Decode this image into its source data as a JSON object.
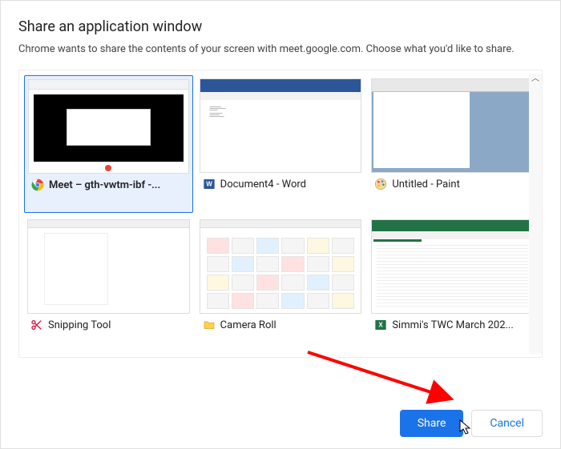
{
  "title": "Share an application window",
  "subtitle": "Chrome wants to share the contents of your screen with meet.google.com. Choose what you'd like to share.",
  "windows": [
    {
      "label": "Meet – gth-vwtm-ibf -...",
      "app": "chrome",
      "selected": true
    },
    {
      "label": "Document4 - Word",
      "app": "word",
      "selected": false
    },
    {
      "label": "Untitled - Paint",
      "app": "paint",
      "selected": false
    },
    {
      "label": "Snipping Tool",
      "app": "snip",
      "selected": false
    },
    {
      "label": "Camera Roll",
      "app": "folder",
      "selected": false
    },
    {
      "label": "Simmi's TWC March 202...",
      "app": "excel",
      "selected": false
    }
  ],
  "buttons": {
    "share": "Share",
    "cancel": "Cancel"
  },
  "colors": {
    "primary": "#1a73e8",
    "word": "#2b579a",
    "excel": "#217346",
    "arrow": "#ff0000"
  }
}
